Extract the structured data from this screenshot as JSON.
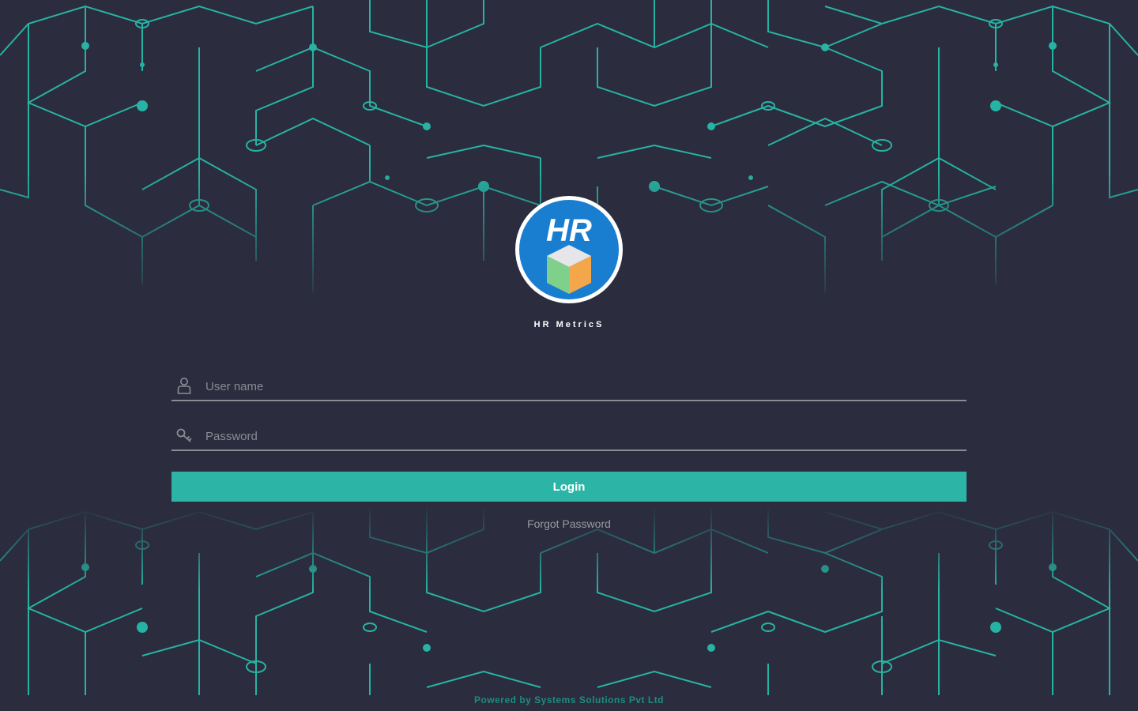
{
  "app": {
    "logo_text": "HR",
    "name": "HR MetricS"
  },
  "form": {
    "username_placeholder": "User name",
    "username_value": "",
    "password_placeholder": "Password",
    "password_value": "",
    "login_label": "Login",
    "forgot_label": "Forgot Password"
  },
  "footer": {
    "text": "Powered by Systems Solutions Pvt Ltd"
  },
  "icons": {
    "username": "user-icon",
    "password": "key-icon"
  },
  "colors": {
    "background": "#2b2c3d",
    "accent": "#2cb5a6",
    "circuit": "#27b3a3",
    "logo_blue": "#1a7ed0"
  }
}
